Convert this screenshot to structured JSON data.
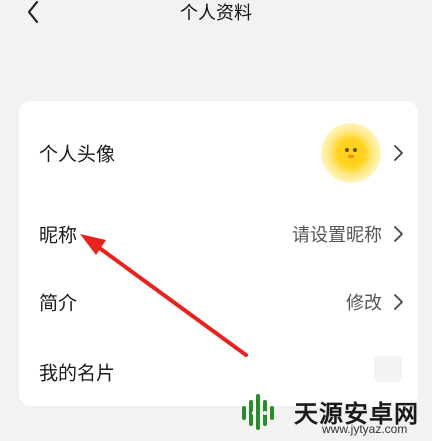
{
  "header": {
    "back_icon": "chevron-left-icon",
    "title": "个人资料"
  },
  "profile": {
    "rows": [
      {
        "label": "个人头像",
        "value": "",
        "icon": "chevron-right-icon"
      },
      {
        "label": "昵称",
        "value": "请设置昵称",
        "icon": "chevron-right-icon"
      },
      {
        "label": "简介",
        "value": "修改",
        "icon": "chevron-right-icon"
      },
      {
        "label": "我的名片",
        "value": ""
      }
    ]
  },
  "annotation": {
    "arrow_color": "#e8231e"
  },
  "watermark": {
    "name": "天源安卓网",
    "url": "www.jytyaz.com"
  }
}
